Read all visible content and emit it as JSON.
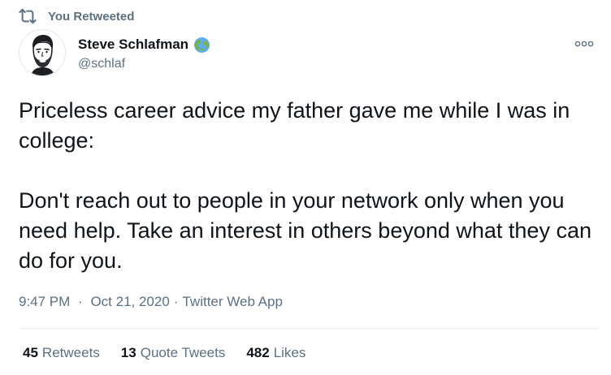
{
  "retweet_banner": {
    "label": "You Retweeted",
    "icon": "retweet-icon"
  },
  "author": {
    "display_name": "Steve Schlafman",
    "handle": "@schlaf",
    "badge_icon": "globe-emoji-icon",
    "avatar": "avatar-illustration"
  },
  "more_menu_icon": "more-dots-icon",
  "tweet": {
    "paragraphs": [
      "Priceless career advice my father gave me while I was in college:",
      "Don't reach out to people in your network only when you need help. Take an interest in others beyond what they can do for you."
    ]
  },
  "meta": {
    "time": "9:47 PM",
    "separator": "·",
    "date": "Oct 21, 2020",
    "source": "Twitter Web App"
  },
  "stats": {
    "retweets": {
      "count": "45",
      "label": "Retweets"
    },
    "quote_tweets": {
      "count": "13",
      "label": "Quote Tweets"
    },
    "likes": {
      "count": "482",
      "label": "Likes"
    }
  },
  "colors": {
    "text": "#0f1419",
    "secondary": "#5b7083",
    "divider": "#ebeef0"
  }
}
